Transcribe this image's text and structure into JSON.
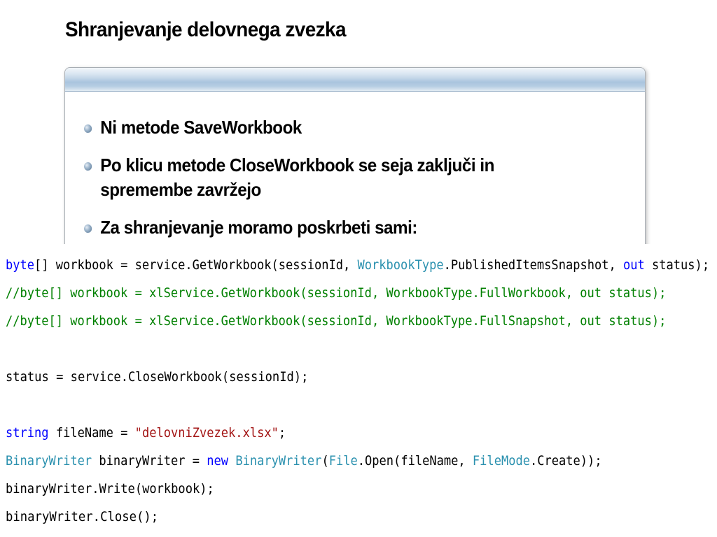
{
  "slide": {
    "title": "Shranjevanje delovnega zvezka",
    "bullets": [
      "Ni metode SaveWorkbook",
      "Po klicu metode CloseWorkbook se seja zaključi in spremembe zavržejo",
      "Za shranjevanje moramo poskrbeti sami:"
    ]
  },
  "code": {
    "line1": {
      "t1": "byte",
      "t2": "[] workbook = service.GetWorkbook(sessionId, ",
      "t3": "WorkbookType",
      "t4": ".PublishedItemsSnapshot, ",
      "t5": "out",
      "t6": " status);"
    },
    "line2": "//byte[] workbook = xlService.GetWorkbook(sessionId, WorkbookType.FullWorkbook, out status);",
    "line3": "//byte[] workbook = xlService.GetWorkbook(sessionId, WorkbookType.FullSnapshot, out status);",
    "line4": "status = service.CloseWorkbook(sessionId);",
    "line5": {
      "t1": "string",
      "t2": " fileName = ",
      "t3": "\"delovniZvezek.xlsx\"",
      "t4": ";"
    },
    "line6": {
      "t1": "BinaryWriter",
      "t2": " binaryWriter = ",
      "t3": "new",
      "t4": " ",
      "t5": "BinaryWriter",
      "t6": "(",
      "t7": "File",
      "t8": ".Open(fileName, ",
      "t9": "FileMode",
      "t10": ".Create));"
    },
    "line7": "binaryWriter.Write(workbook);",
    "line8": "binaryWriter.Close();"
  },
  "colors": {
    "keyword": "#0000ff",
    "type": "#2b91af",
    "comment": "#008000",
    "string": "#a31515",
    "panel_header": "#a9c4de"
  },
  "icons": {
    "bullet": "bullet-sphere-icon"
  }
}
